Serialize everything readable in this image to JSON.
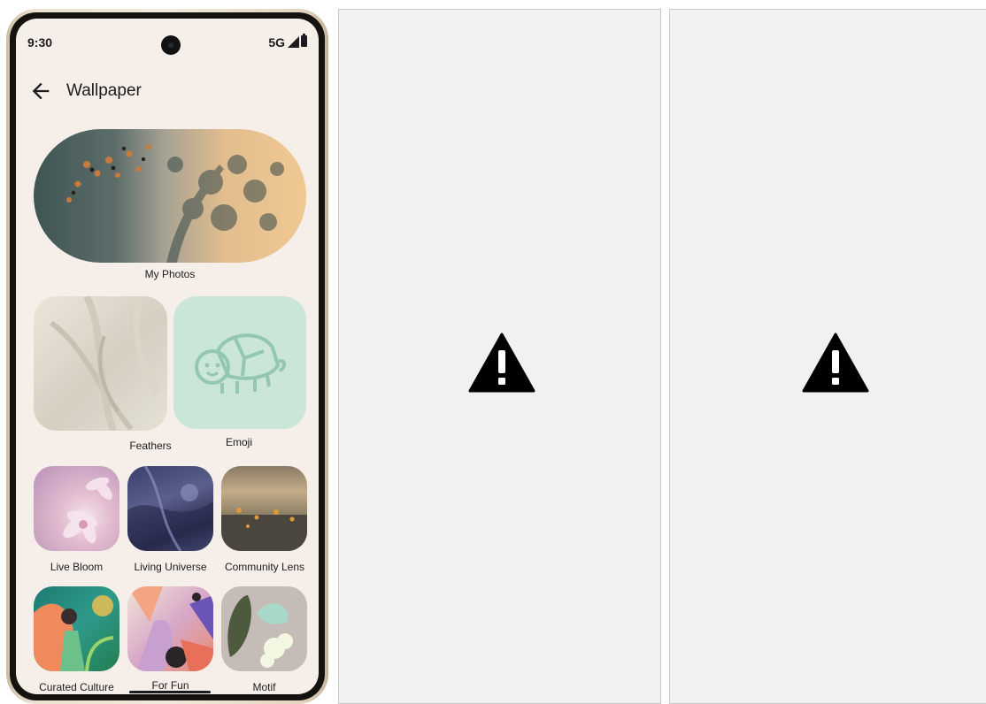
{
  "status_bar": {
    "time": "9:30",
    "network": "5G"
  },
  "app_bar": {
    "title": "Wallpaper"
  },
  "collections": {
    "featured": {
      "label": "My Photos"
    },
    "pair": [
      {
        "label": "Feathers"
      },
      {
        "label": "Emoji"
      }
    ],
    "grid": [
      {
        "label": "Live Bloom"
      },
      {
        "label": "Living Universe"
      },
      {
        "label": "Community Lens"
      },
      {
        "label": "Curated Culture"
      },
      {
        "label": "For Fun"
      },
      {
        "label": "Motif"
      }
    ]
  },
  "placeholders": [
    {
      "icon": "warning-icon"
    },
    {
      "icon": "warning-icon"
    }
  ],
  "colors": {
    "screen_bg": "#f6efe9",
    "emoji_bg": "#c9e6d8",
    "panel_bg": "#f1f1f1"
  }
}
